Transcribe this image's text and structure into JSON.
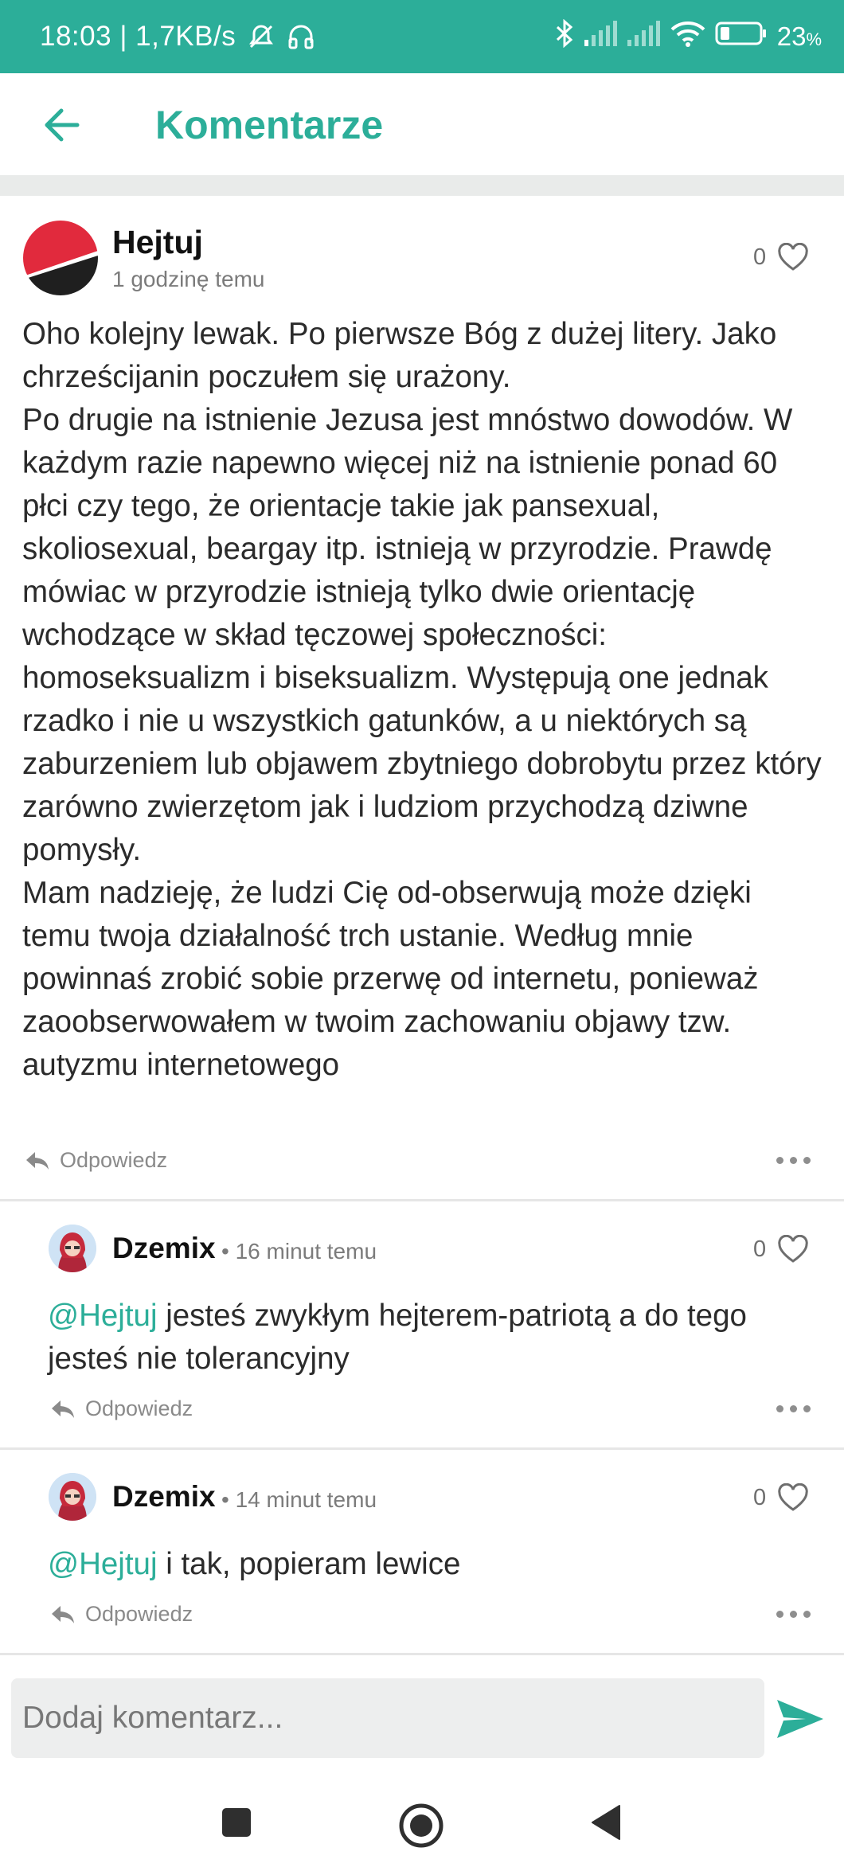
{
  "status_bar": {
    "time": "18:03",
    "network_speed": "1,7KB/s",
    "battery_percent": "23",
    "battery_unit": "%",
    "icons": [
      "mute-icon",
      "headset-icon",
      "bluetooth-icon",
      "signal-icon",
      "signal-icon",
      "wifi-icon",
      "battery-icon"
    ]
  },
  "app_bar": {
    "title": "Komentarze",
    "back_icon": "arrow-left-icon"
  },
  "colors": {
    "accent": "#2cae99",
    "text": "#2b2b2b",
    "muted": "#7b7b7b"
  },
  "main_comment": {
    "author": "Hejtuj",
    "time": "1 godzinę temu",
    "likes": "0",
    "body": "Oho kolejny lewak. Po pierwsze Bóg z dużej litery. Jako chrześcijanin poczułem się urażony.\nPo drugie na istnienie Jezusa jest mnóstwo dowodów. W każdym razie napewno więcej niż na istnienie ponad 60 płci czy tego, że orientacje takie jak pansexual, skoliosexual, beargay itp. istnieją w przyrodzie. Prawdę mówiac w przyrodzie istnieją tylko dwie orientację wchodzące w skład tęczowej społeczności: homoseksualizm i biseksualizm. Występują one jednak rzadko i nie u wszystkich gatunków, a u niektórych są zaburzeniem lub objawem zbytniego dobrobytu przez który zarówno zwierzętom jak i ludziom przychodzą dziwne pomysły.\nMam nadzieję, że ludzi Cię od-obserwują może dzięki temu twoja działalność trch ustanie. Według mnie powinnaś zrobić sobie przerwę od internetu, ponieważ zaoobserwowałem w twoim zachowaniu objawy tzw. autyzmu internetowego",
    "reply_label": "Odpowiedz"
  },
  "replies": [
    {
      "author": "Dzemix",
      "separator": "•",
      "time": "16 minut temu",
      "likes": "0",
      "mention": "@Hejtuj",
      "text": " jesteś zwykłym hejterem-patriotą a do tego jesteś nie tolerancyjny",
      "reply_label": "Odpowiedz"
    },
    {
      "author": "Dzemix",
      "separator": "•",
      "time": "14 minut temu",
      "likes": "0",
      "mention": "@Hejtuj",
      "text": " i tak, popieram lewice",
      "reply_label": "Odpowiedz"
    }
  ],
  "composer": {
    "placeholder": "Dodaj komentarz..."
  },
  "nav": {
    "icons": [
      "recents-square-icon",
      "home-circle-icon",
      "back-triangle-icon"
    ]
  }
}
